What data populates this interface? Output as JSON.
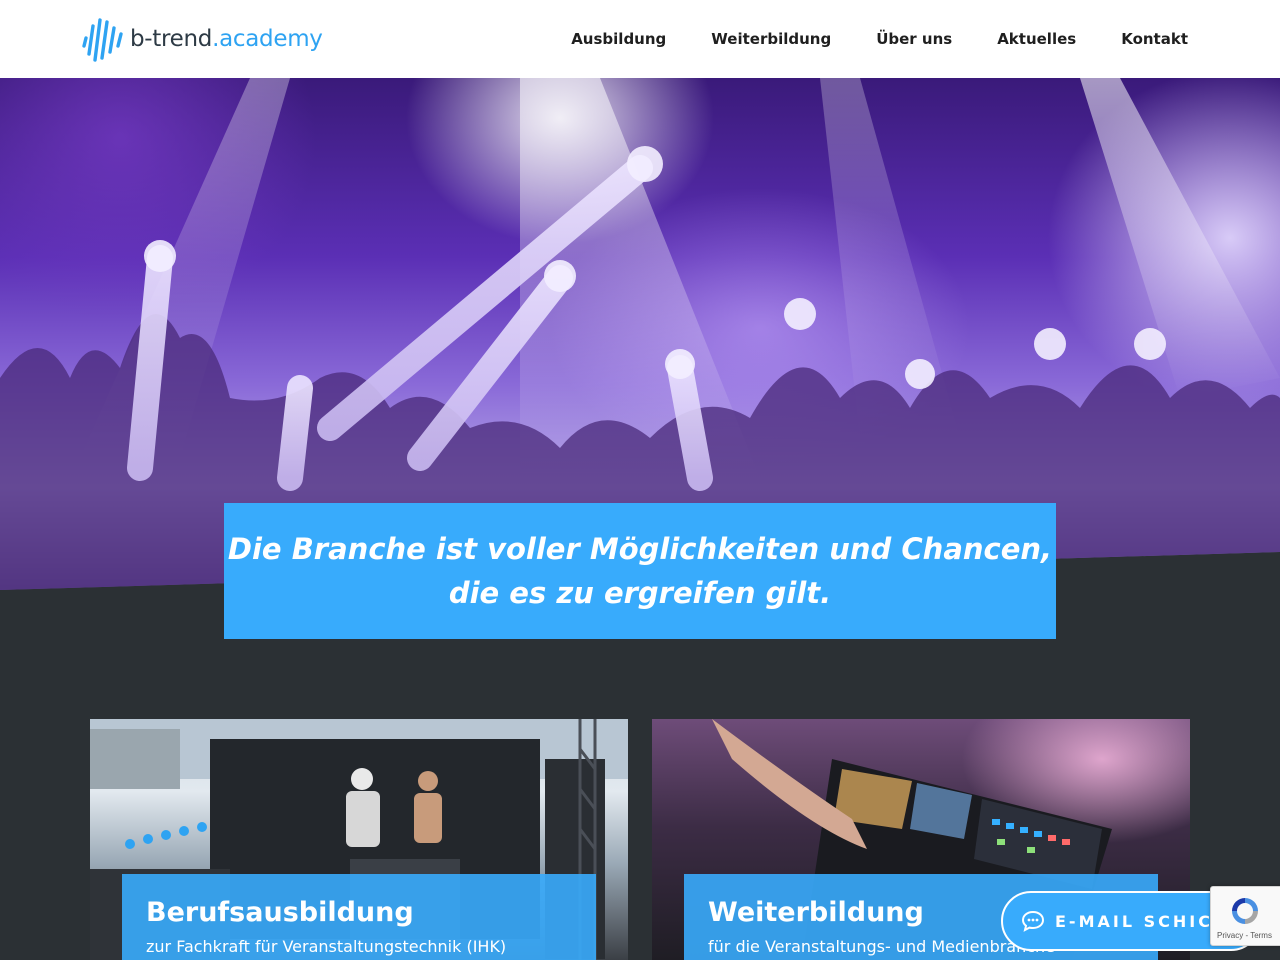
{
  "header": {
    "logo": {
      "brand": "b-trend",
      "suffix": ".academy",
      "icon": "sound-wave-logo-icon"
    },
    "nav": [
      "Ausbildung",
      "Weiterbildung",
      "Über uns",
      "Aktuelles",
      "Kontakt"
    ]
  },
  "hero": {
    "image": "concert-crowd-photo",
    "tagline_line1": "Die Branche ist voller Möglichkeiten und Chancen,",
    "tagline_line2": "die es zu ergreifen gilt."
  },
  "cards": [
    {
      "image": "stage-construction-photo",
      "title": "Berufsausbildung",
      "subtitle": "zur Fachkraft für Veranstaltungstechnik (IHK)"
    },
    {
      "image": "lighting-console-photo",
      "title": "Weiterbildung",
      "subtitle": "für die Veranstaltungs- und Medienbranche"
    }
  ],
  "email_button": {
    "label": "E-MAIL SCHICKEN",
    "icon": "chat-bubble-icon"
  },
  "recaptcha": {
    "links": "Privacy - Terms",
    "icon": "recaptcha-icon"
  },
  "colors": {
    "accent": "#38abfc",
    "dark_bg": "#2b3034",
    "nav_text": "#1f1f1f"
  }
}
